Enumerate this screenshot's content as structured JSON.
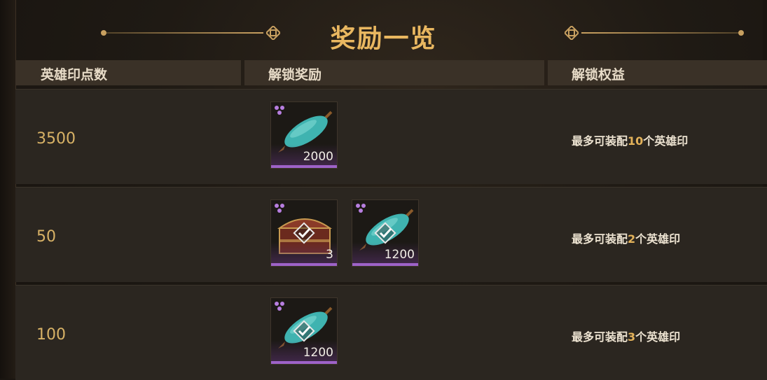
{
  "title": "奖励一览",
  "header": {
    "col_points": "英雄印点数",
    "col_rewards": "解锁奖励",
    "col_benefits": "解锁权益"
  },
  "rows": [
    {
      "points": "3500",
      "benefit_prefix": "最多可装配",
      "benefit_num": "10",
      "benefit_suffix": "个英雄印",
      "items": [
        {
          "icon": "teal-seed-pod-icon",
          "qty": "2000",
          "claimed": false
        }
      ]
    },
    {
      "points": "50",
      "benefit_prefix": "最多可装配",
      "benefit_num": "2",
      "benefit_suffix": "个英雄印",
      "items": [
        {
          "icon": "treasure-chest-icon",
          "qty": "3",
          "claimed": true
        },
        {
          "icon": "teal-seed-pod-icon",
          "qty": "1200",
          "claimed": true
        }
      ]
    },
    {
      "points": "100",
      "benefit_prefix": "最多可装配",
      "benefit_num": "3",
      "benefit_suffix": "个英雄印",
      "items": [
        {
          "icon": "teal-seed-pod-icon",
          "qty": "1200",
          "claimed": true
        }
      ]
    }
  ],
  "colors": {
    "accent": "#e9b760",
    "rarity": "#9e62c8",
    "highlight": "#e3b25a"
  }
}
